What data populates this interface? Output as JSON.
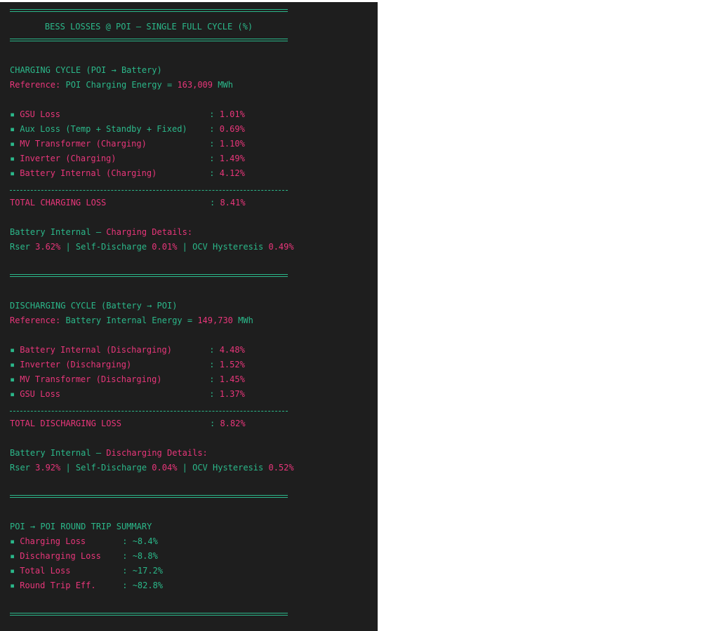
{
  "title": "BESS LOSSES @ POI – SINGLE FULL CYCLE (%)",
  "charging": {
    "heading": "CHARGING CYCLE (POI → Battery)",
    "ref_label": "Reference: ",
    "ref_mid": "POI Charging Energy = ",
    "ref_value": "163,009",
    "ref_unit": " MWh",
    "items": [
      {
        "label": "GSU Loss",
        "value": "1.01%"
      },
      {
        "label": "Aux Loss (Temp + Standby + Fixed)",
        "value": "0.69%"
      },
      {
        "label": "MV Transformer (Charging)",
        "value": "1.10%"
      },
      {
        "label": "Inverter (Charging)",
        "value": "1.49%"
      },
      {
        "label": "Battery Internal (Charging)",
        "value": "4.12%"
      }
    ],
    "total_label": "TOTAL CHARGING LOSS",
    "total_value": "8.41%",
    "details_title_a": "Battery Internal – ",
    "details_title_b": "Charging Details:",
    "rser_label": "Rser ",
    "rser_value": "3.62%",
    "sd_label": " | Self-Discharge ",
    "sd_value": "0.01%",
    "ocv_label": " | OCV Hysteresis ",
    "ocv_value": "0.49%"
  },
  "discharging": {
    "heading": "DISCHARGING CYCLE (Battery → POI)",
    "ref_label": "Reference: ",
    "ref_mid": "Battery Internal Energy = ",
    "ref_value": "149,730",
    "ref_unit": " MWh",
    "items": [
      {
        "label": "Battery Internal (Discharging)",
        "value": "4.48%"
      },
      {
        "label": "Inverter (Discharging)",
        "value": "1.52%"
      },
      {
        "label": "MV Transformer (Discharging)",
        "value": "1.45%"
      },
      {
        "label": "GSU Loss",
        "value": "1.37%"
      }
    ],
    "total_label": "TOTAL DISCHARGING LOSS",
    "total_value": "8.82%",
    "details_title_a": "Battery Internal – ",
    "details_title_b": "Discharging Details:",
    "rser_label": "Rser ",
    "rser_value": "3.92%",
    "sd_label": " | Self-Discharge ",
    "sd_value": "0.04%",
    "ocv_label": " | OCV Hysteresis ",
    "ocv_value": "0.52%"
  },
  "summary": {
    "heading": "POI → POI ROUND TRIP SUMMARY",
    "items": [
      {
        "label": "Charging Loss",
        "value": "~8.4%"
      },
      {
        "label": "Discharging Loss",
        "value": "~8.8%"
      },
      {
        "label": "Total Loss",
        "value": "~17.2%"
      },
      {
        "label": "Round Trip Eff.",
        "value": "~82.8%"
      }
    ]
  },
  "bullet": "▪",
  "colon": ": ",
  "colors": {
    "teal": "#2bb88a",
    "pink": "#e8367a",
    "background": "#1e1e1e"
  }
}
